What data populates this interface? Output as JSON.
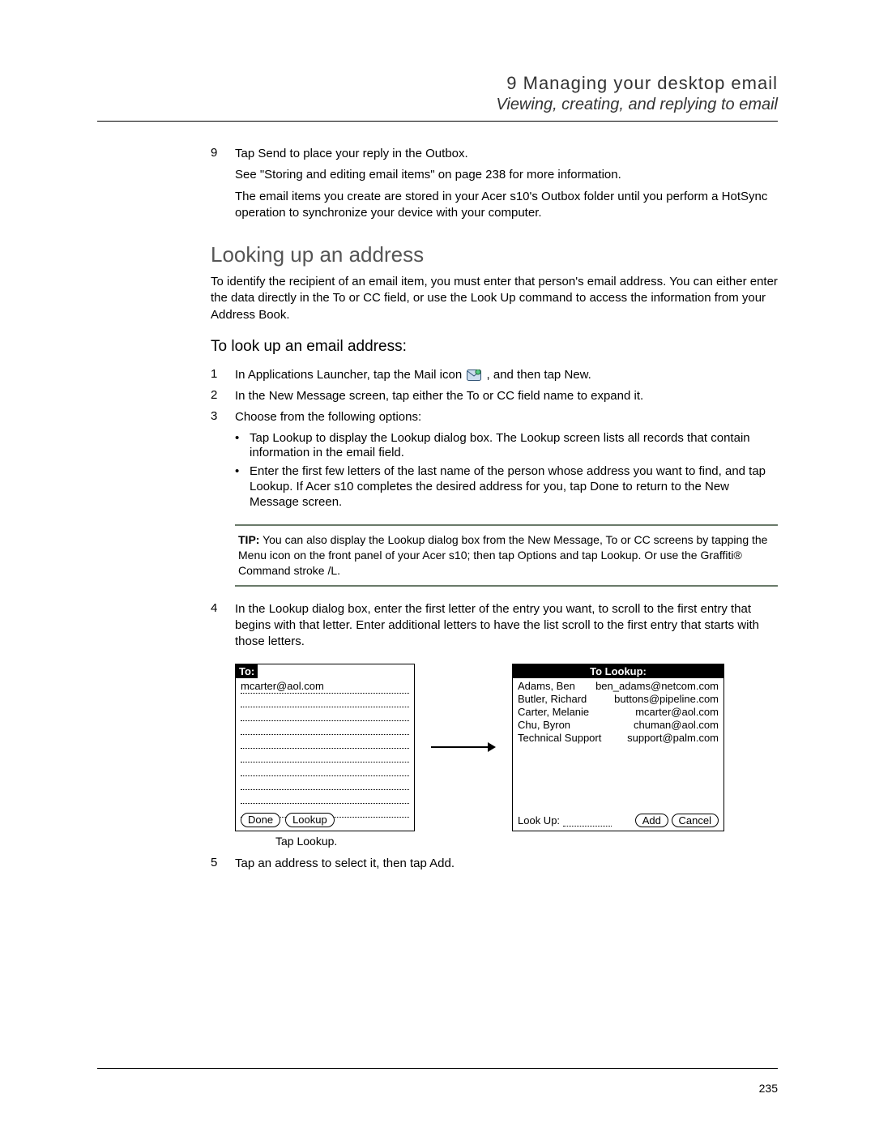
{
  "header": {
    "chapter": "9 Managing your desktop email",
    "subtitle": "Viewing, creating, and replying to email"
  },
  "intro": {
    "step9_num": "9",
    "step9_text": "Tap Send to place your reply in the Outbox.",
    "see_ref": "See \"Storing and editing email items\" on page 238 for more information.",
    "note": "The email items you create are stored in your Acer s10's Outbox folder until you perform a HotSync operation to synchronize your device with your computer."
  },
  "section": {
    "h2": "Looking up an address",
    "intro_para": "To identify the recipient of an email item, you must enter that person's email address. You can either enter the data directly in the To or CC field, or use the Look Up command to access the information from your Address Book.",
    "h3": "To look up an email address:"
  },
  "steps": {
    "s1_num": "1",
    "s1_a": "In Applications Launcher, tap the Mail icon ",
    "s1_b": ", and then tap New.",
    "s2_num": "2",
    "s2": "In the New Message screen, tap either the To or CC field name to expand it.",
    "s3_num": "3",
    "s3": "Choose from the following options:",
    "b1": "Tap Lookup to display the Lookup dialog box. The Lookup screen lists all records that contain information in the email field.",
    "b2": "Enter the first few letters of the last name of the person whose address you want to find, and tap Lookup. If Acer s10 completes the desired address for you, tap Done to return to the New Message screen.",
    "s4_num": "4",
    "s4": "In the Lookup dialog box, enter the first letter of the entry you want, to scroll to the first entry that begins with that letter. Enter additional letters to have the list scroll to the first entry that starts with those letters.",
    "s5_num": "5",
    "s5": "Tap an address to select it, then tap Add."
  },
  "tip": {
    "label": "TIP:",
    "text": "   You can also display the Lookup dialog box from the New Message, To or CC screens by tapping the Menu icon on the front panel of your Acer s10; then tap Options and tap Lookup. Or use the Graffiti® Command stroke /L."
  },
  "fig_left": {
    "header": "To:",
    "value": "mcarter@aol.com",
    "btn_done": "Done",
    "btn_lookup": "Lookup",
    "caption": "Tap Lookup."
  },
  "fig_right": {
    "header": "To Lookup:",
    "r1n": "Adams, Ben",
    "r1e": "ben_adams@netcom.com",
    "r2n": "Butler, Richard",
    "r2e": "buttons@pipeline.com",
    "r3n": "Carter, Melanie",
    "r3e": "mcarter@aol.com",
    "r4n": "Chu, Byron",
    "r4e": "chuman@aol.com",
    "r5n": "Technical Support",
    "r5e": "support@palm.com",
    "bottom_label": "Look Up:",
    "btn_add": "Add",
    "btn_cancel": "Cancel"
  },
  "page_number": "235"
}
